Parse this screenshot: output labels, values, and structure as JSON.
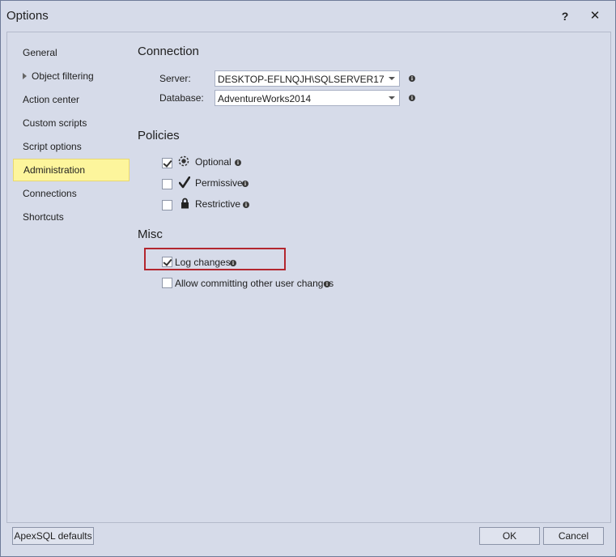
{
  "window": {
    "title": "Options",
    "help_label": "?",
    "close_label": "✕"
  },
  "nav": {
    "items": [
      {
        "label": "General"
      },
      {
        "label": "Object filtering"
      },
      {
        "label": "Action center"
      },
      {
        "label": "Custom scripts"
      },
      {
        "label": "Script options"
      },
      {
        "label": "Administration"
      },
      {
        "label": "Connections"
      },
      {
        "label": "Shortcuts"
      }
    ],
    "active": "Administration"
  },
  "connection": {
    "title": "Connection",
    "server_label": "Server:",
    "server_value": "DESKTOP-EFLNQJH\\SQLSERVER17",
    "database_label": "Database:",
    "database_value": "AdventureWorks2014"
  },
  "policies": {
    "title": "Policies",
    "optional": {
      "label": "Optional",
      "checked": true
    },
    "permissive": {
      "label": "Permissive",
      "checked": false
    },
    "restrictive": {
      "label": "Restrictive",
      "checked": false
    }
  },
  "misc": {
    "title": "Misc",
    "log_changes": {
      "label": "Log changes",
      "checked": true
    },
    "allow_committing": {
      "label": "Allow committing other user changes",
      "checked": false
    }
  },
  "footer": {
    "defaults_label": "ApexSQL defaults",
    "ok_label": "OK",
    "cancel_label": "Cancel"
  },
  "info_glyph": "i",
  "colors": {
    "active_nav_bg": "#fdf59c",
    "highlight_border": "#b3262e",
    "window_bg": "#d6dbe9"
  }
}
